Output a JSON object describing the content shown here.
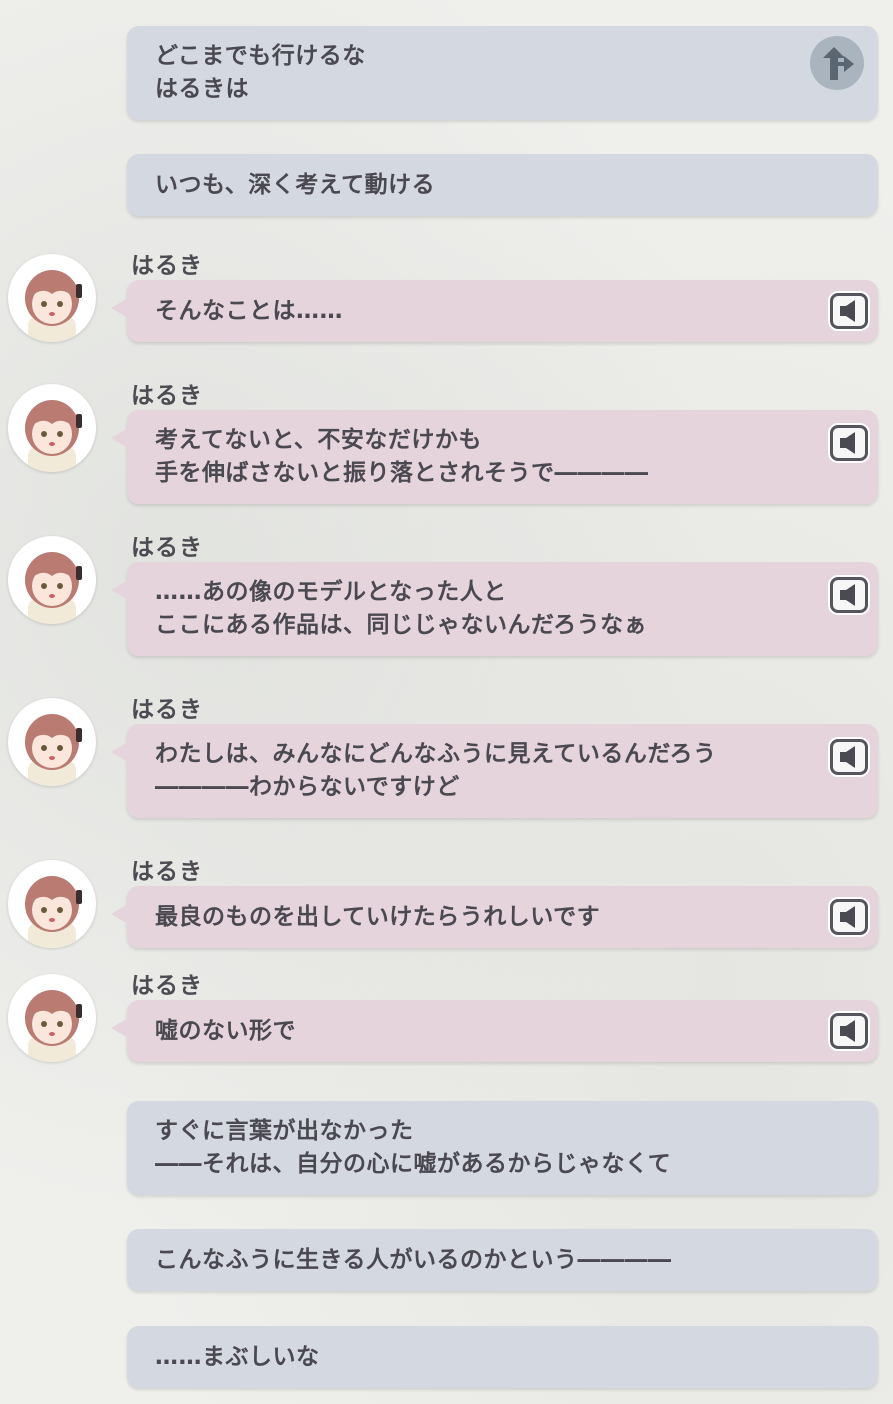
{
  "messages": [
    {
      "type": "self",
      "lines": [
        "どこまでも行けるな",
        "はるきは"
      ],
      "branch_icon": "branch-arrow-icon"
    },
    {
      "type": "self",
      "lines": [
        "いつも、深く考えて動ける"
      ]
    },
    {
      "type": "char",
      "name": "はるき",
      "lines": [
        "そんなことは……"
      ],
      "voice_icon": "speaker-icon"
    },
    {
      "type": "char",
      "name": "はるき",
      "lines": [
        "考えてないと、不安なだけかも",
        "手を伸ばさないと振り落とされそうで――――"
      ],
      "voice_icon": "speaker-icon"
    },
    {
      "type": "char",
      "name": "はるき",
      "lines": [
        "……あの像のモデルとなった人と",
        "ここにある作品は、同じじゃないんだろうなぁ"
      ],
      "voice_icon": "speaker-icon"
    },
    {
      "type": "char",
      "name": "はるき",
      "lines": [
        "わたしは、みんなにどんなふうに見えているんだろう",
        "――――わからないですけど"
      ],
      "voice_icon": "speaker-icon"
    },
    {
      "type": "char",
      "name": "はるき",
      "lines": [
        "最良のものを出していけたらうれしいです"
      ],
      "voice_icon": "speaker-icon"
    },
    {
      "type": "char",
      "name": "はるき",
      "lines": [
        "嘘のない形で"
      ],
      "voice_icon": "speaker-icon"
    },
    {
      "type": "self",
      "lines": [
        "すぐに言葉が出なかった",
        "――それは、自分の心に嘘があるからじゃなくて"
      ]
    },
    {
      "type": "self",
      "lines": [
        "こんなふうに生きる人がいるのかという――――"
      ]
    },
    {
      "type": "self",
      "lines": [
        "……まぶしいな"
      ]
    }
  ],
  "colors": {
    "self_bubble": "#d4d9e1",
    "char_bubble": "#e6d4dd",
    "text": "#4a4850",
    "hair": "#b97b72"
  }
}
